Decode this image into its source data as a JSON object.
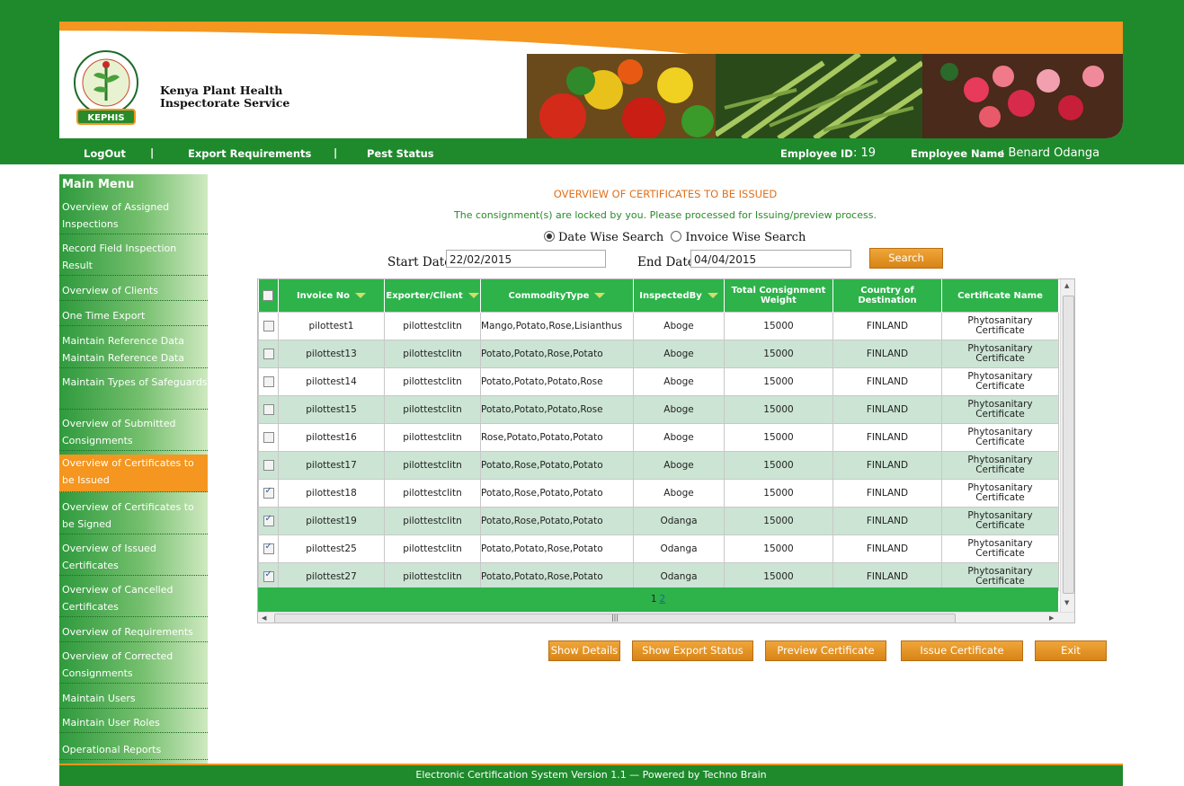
{
  "header": {
    "org_name_line1": "Kenya Plant Health",
    "org_name_line2": "Inspectorate Service",
    "logo_text": "KEPHIS",
    "brand_colors": {
      "green": "#1e8a2c",
      "orange": "#f4961f"
    }
  },
  "nav": {
    "logout": "LogOut",
    "export_requirements": "Export Requirements",
    "pest_status": "Pest Status",
    "separator": "|",
    "employee_id_label": "Employee ID",
    "employee_id_value": ": 19",
    "employee_name_label": "Employee Name",
    "employee_name_value": ": Benard Odanga"
  },
  "sidebar": {
    "title": "Main Menu",
    "items": [
      {
        "label": "Overview of Assigned Inspections"
      },
      {
        "label": "Record Field Inspection Result"
      },
      {
        "label": "Overview of Clients"
      },
      {
        "label": "One Time Export"
      },
      {
        "label": "Maintain Reference Data Maintain Reference Data"
      },
      {
        "label": "Maintain Types of Safeguards"
      },
      {
        "label": "Overview of Submitted Consignments"
      },
      {
        "label": "Overview of Certificates to be Issued",
        "active": true
      },
      {
        "label": "Overview of Certificates to be Signed"
      },
      {
        "label": "Overview of Issued Certificates"
      },
      {
        "label": "Overview of Cancelled Certificates"
      },
      {
        "label": "Overview of Requirements"
      },
      {
        "label": "Overview of Corrected Consignments"
      },
      {
        "label": "Maintain Users"
      },
      {
        "label": "Maintain User Roles"
      },
      {
        "label": "Operational Reports"
      }
    ]
  },
  "main": {
    "title": "OVERVIEW OF CERTIFICATES TO BE ISSUED",
    "subtitle": "The consignment(s) are locked by you. Please processed for Issuing/preview process.",
    "search_mode": {
      "date_wise": "Date Wise Search",
      "invoice_wise": "Invoice Wise Search",
      "selected": "date_wise"
    },
    "start_date_label": "Start Date",
    "start_date_value": "22/02/2015",
    "end_date_label": "End Date",
    "end_date_value": "04/04/2015",
    "search_button": "Search"
  },
  "grid": {
    "columns": [
      "Invoice No",
      "Exporter/Client",
      "CommodityType",
      "InspectedBy",
      "Total Consignment Weight",
      "Country of Destination",
      "Certificate Name"
    ],
    "rows": [
      {
        "checked": false,
        "invoice": "pilottest1",
        "client": "pilottestclitn",
        "commodity": "Mango,Potato,Rose,Lisianthus",
        "inspected_by": "Aboge",
        "weight": "15000",
        "country": "FINLAND",
        "certificate": "Phytosanitary Certificate"
      },
      {
        "checked": false,
        "invoice": "pilottest13",
        "client": "pilottestclitn",
        "commodity": "Potato,Potato,Rose,Potato",
        "inspected_by": "Aboge",
        "weight": "15000",
        "country": "FINLAND",
        "certificate": "Phytosanitary Certificate"
      },
      {
        "checked": false,
        "invoice": "pilottest14",
        "client": "pilottestclitn",
        "commodity": "Potato,Potato,Potato,Rose",
        "inspected_by": "Aboge",
        "weight": "15000",
        "country": "FINLAND",
        "certificate": "Phytosanitary Certificate"
      },
      {
        "checked": false,
        "invoice": "pilottest15",
        "client": "pilottestclitn",
        "commodity": "Potato,Potato,Potato,Rose",
        "inspected_by": "Aboge",
        "weight": "15000",
        "country": "FINLAND",
        "certificate": "Phytosanitary Certificate"
      },
      {
        "checked": false,
        "invoice": "pilottest16",
        "client": "pilottestclitn",
        "commodity": "Rose,Potato,Potato,Potato",
        "inspected_by": "Aboge",
        "weight": "15000",
        "country": "FINLAND",
        "certificate": "Phytosanitary Certificate"
      },
      {
        "checked": false,
        "invoice": "pilottest17",
        "client": "pilottestclitn",
        "commodity": "Potato,Rose,Potato,Potato",
        "inspected_by": "Aboge",
        "weight": "15000",
        "country": "FINLAND",
        "certificate": "Phytosanitary Certificate"
      },
      {
        "checked": true,
        "invoice": "pilottest18",
        "client": "pilottestclitn",
        "commodity": "Potato,Rose,Potato,Potato",
        "inspected_by": "Aboge",
        "weight": "15000",
        "country": "FINLAND",
        "certificate": "Phytosanitary Certificate"
      },
      {
        "checked": true,
        "invoice": "pilottest19",
        "client": "pilottestclitn",
        "commodity": "Potato,Rose,Potato,Potato",
        "inspected_by": "Odanga",
        "weight": "15000",
        "country": "FINLAND",
        "certificate": "Phytosanitary Certificate"
      },
      {
        "checked": true,
        "invoice": "pilottest25",
        "client": "pilottestclitn",
        "commodity": "Potato,Potato,Rose,Potato",
        "inspected_by": "Odanga",
        "weight": "15000",
        "country": "FINLAND",
        "certificate": "Phytosanitary Certificate"
      },
      {
        "checked": true,
        "invoice": "pilottest27",
        "client": "pilottestclitn",
        "commodity": "Potato,Potato,Rose,Potato",
        "inspected_by": "Odanga",
        "weight": "15000",
        "country": "FINLAND",
        "certificate": "Phytosanitary Certificate"
      }
    ],
    "pager": {
      "current": "1",
      "next": "2"
    }
  },
  "actions": {
    "show_details": "Show Details",
    "show_export_status": "Show Export Status",
    "preview_certificate": "Preview Certificate",
    "issue_certificate": "Issue Certificate",
    "exit": "Exit"
  },
  "footer": {
    "text": "Electronic Certification System Version 1.1 — Powered by Techno Brain"
  }
}
